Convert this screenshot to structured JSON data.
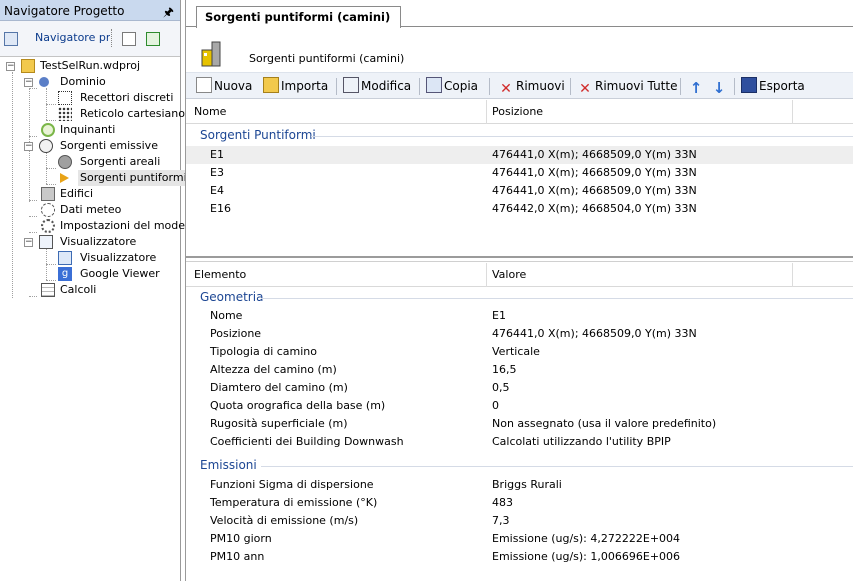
{
  "navigator": {
    "title": "Navigatore Progetto",
    "tab_label": "Navigatore progetto",
    "tree": [
      {
        "label": "TestSelRun.wdproj",
        "icon": "project-folder-icon"
      },
      {
        "label": "Dominio",
        "icon": "domain-icon"
      },
      {
        "label": "Recettori discreti",
        "icon": "discrete-receptors-icon"
      },
      {
        "label": "Reticolo cartesiano",
        "icon": "cartesian-grid-icon"
      },
      {
        "label": "Inquinanti",
        "icon": "pollutants-icon"
      },
      {
        "label": "Sorgenti emissive",
        "icon": "emission-sources-icon"
      },
      {
        "label": "Sorgenti areali",
        "icon": "area-sources-icon"
      },
      {
        "label": "Sorgenti puntiformi",
        "icon": "point-sources-icon"
      },
      {
        "label": "Edifici",
        "icon": "buildings-icon"
      },
      {
        "label": "Dati meteo",
        "icon": "weather-data-icon"
      },
      {
        "label": "Impostazioni del modello",
        "icon": "model-settings-icon"
      },
      {
        "label": "Visualizzatore",
        "icon": "viewer-folder-icon"
      },
      {
        "label": "Visualizzatore",
        "icon": "viewer-icon"
      },
      {
        "label": "Google Viewer",
        "icon": "google-viewer-icon"
      },
      {
        "label": "Calcoli",
        "icon": "calculations-icon"
      }
    ]
  },
  "document": {
    "tab_title": "Sorgenti puntiformi (camini)",
    "header_title": "Sorgenti puntiformi (camini)"
  },
  "toolbar": {
    "nuova": "Nuova",
    "importa": "Importa",
    "modifica": "Modifica",
    "copia": "Copia",
    "rimuovi": "Rimuovi",
    "rimuovi_tutte": "Rimuovi Tutte",
    "esporta": "Esporta"
  },
  "sources_grid": {
    "col_name": "Nome",
    "col_position": "Posizione",
    "group": "Sorgenti Puntiformi",
    "rows": [
      {
        "name": "E1",
        "position": "476441,0 X(m); 4668509,0 Y(m) 33N"
      },
      {
        "name": "E3",
        "position": "476441,0 X(m); 4668509,0 Y(m) 33N"
      },
      {
        "name": "E4",
        "position": "476441,0 X(m); 4668509,0 Y(m) 33N"
      },
      {
        "name": "E16",
        "position": "476442,0 X(m); 4668504,0 Y(m) 33N"
      }
    ]
  },
  "properties_grid": {
    "col_element": "Elemento",
    "col_value": "Valore",
    "geometry_group": "Geometria",
    "geometry": [
      {
        "name": "Nome",
        "value": "E1"
      },
      {
        "name": "Posizione",
        "value": "476441,0 X(m); 4668509,0 Y(m) 33N"
      },
      {
        "name": "Tipologia di camino",
        "value": "Verticale"
      },
      {
        "name": "Altezza del camino (m)",
        "value": "16,5"
      },
      {
        "name": "Diamtero del camino (m)",
        "value": "0,5"
      },
      {
        "name": "Quota orografica della base (m)",
        "value": "0"
      },
      {
        "name": "Rugosità superficiale (m)",
        "value": "Non assegnato (usa il valore predefinito)"
      },
      {
        "name": "Coefficienti dei Building Downwash",
        "value": "Calcolati utilizzando l'utility BPIP"
      }
    ],
    "emissions_group": "Emissioni",
    "emissions": [
      {
        "name": "Funzioni Sigma di dispersione",
        "value": "Briggs Rurali"
      },
      {
        "name": "Temperatura di emissione (°K)",
        "value": "483"
      },
      {
        "name": "Velocità di emissione (m/s)",
        "value": "7,3"
      },
      {
        "name": "PM10 giorn",
        "value": "Emissione (ug/s): 4,272222E+004"
      },
      {
        "name": "PM10 ann",
        "value": "Emissione (ug/s): 1,006696E+006"
      }
    ]
  }
}
